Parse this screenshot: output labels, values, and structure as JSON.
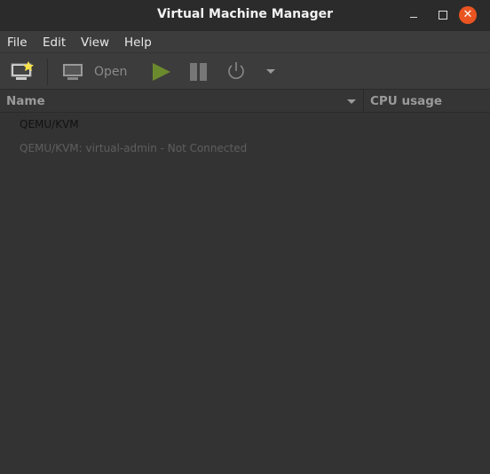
{
  "window": {
    "title": "Virtual Machine Manager"
  },
  "menu": [
    "File",
    "Edit",
    "View",
    "Help"
  ],
  "toolbar": {
    "open_label": "Open"
  },
  "columns": {
    "name": "Name",
    "cpu": "CPU usage"
  },
  "connections": [
    {
      "label": "QEMU/KVM"
    },
    {
      "label": "QEMU/KVM: virtual-admin - Not Connected"
    }
  ],
  "colors": {
    "close": "#e95420",
    "play": "#6b8a2e"
  }
}
